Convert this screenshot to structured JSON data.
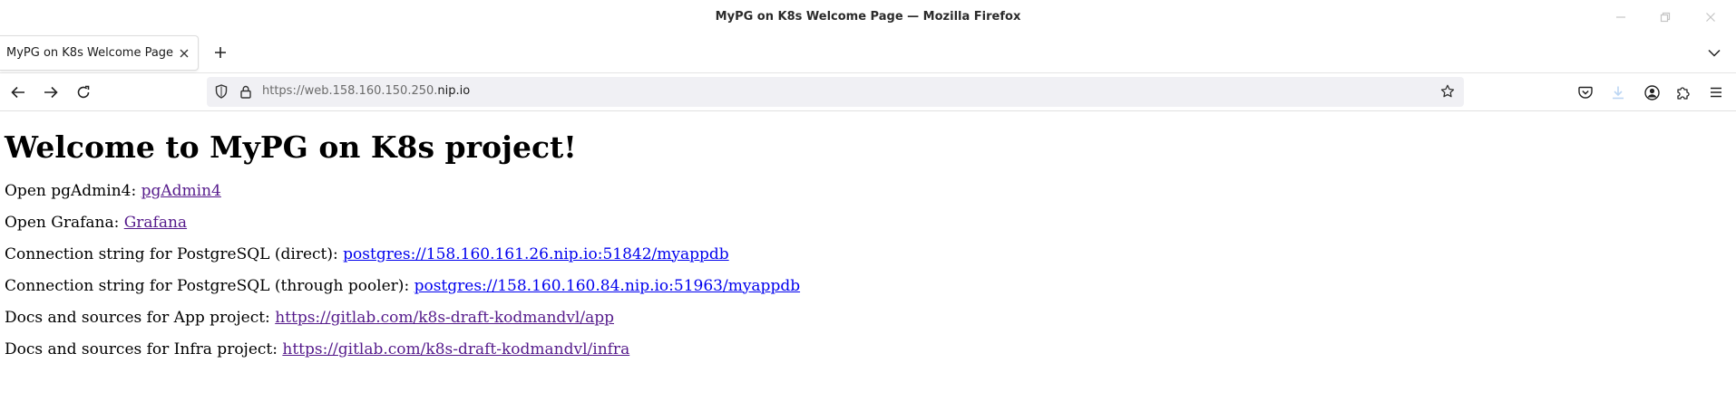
{
  "window": {
    "title": "MyPG on K8s Welcome Page — Mozilla Firefox"
  },
  "tabs": [
    {
      "label": "MyPG on K8s Welcome Page",
      "active": true
    }
  ],
  "urlbar": {
    "prefix": "https://web.158.160.150.250.",
    "domain": "nip.io"
  },
  "page": {
    "heading": "Welcome to MyPG on K8s project!",
    "rows": [
      {
        "label": "Open pgAdmin4: ",
        "link": "pgAdmin4"
      },
      {
        "label": "Open Grafana: ",
        "link": "Grafana"
      },
      {
        "label": "Connection string for PostgreSQL (direct): ",
        "link": "postgres://158.160.161.26.nip.io:51842/myappdb"
      },
      {
        "label": "Connection string for PostgreSQL (through pooler): ",
        "link": "postgres://158.160.160.84.nip.io:51963/myappdb"
      },
      {
        "label": "Docs and sources for App project: ",
        "link": "https://gitlab.com/k8s-draft-kodmandvl/app"
      },
      {
        "label": "Docs and sources for Infra project: ",
        "link": "https://gitlab.com/k8s-draft-kodmandvl/infra"
      }
    ]
  },
  "colors": {
    "visited_link": "#551a8b",
    "unvisited_link": "#0000ee"
  }
}
